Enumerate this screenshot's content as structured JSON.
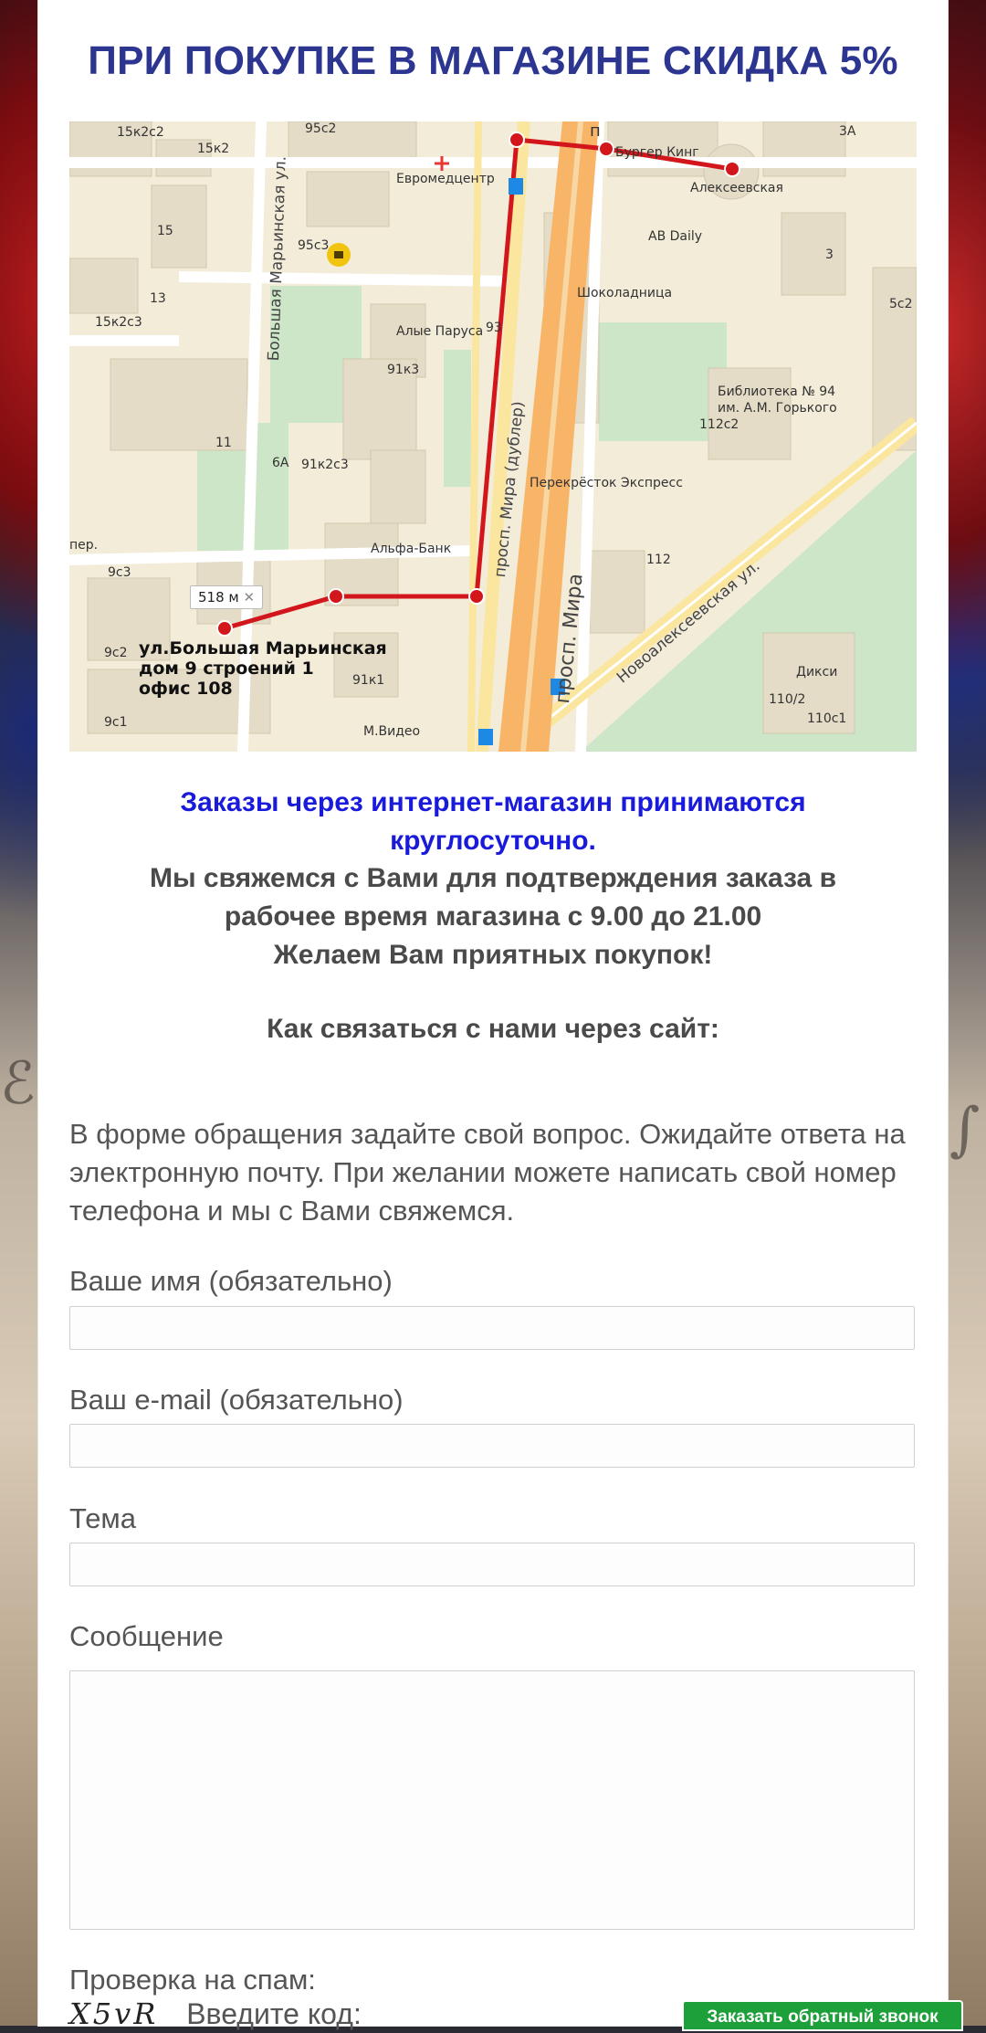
{
  "heading": "ПРИ ПОКУПКЕ В МАГАЗИНЕ СКИДКА 5%",
  "map": {
    "distance": "518 м",
    "address_lines": [
      "ул.Большая Марьинская",
      "дом 9 строений 1",
      "офис 108"
    ],
    "labels": {
      "euromed": "Евромедцентр",
      "burger": "Бургер Кинг",
      "alekseevskaya": "Алексеевская",
      "abdaily": "AB Daily",
      "shokoladnitsa": "Шоколадница",
      "alye_parusa": "Алые Паруса",
      "library_1": "Библиотека № 94",
      "library_2": "им. А.М. Горького",
      "perekrestok": "Перекрёсток Экспресс",
      "alfabank": "Альфа-Банк",
      "mvideo": "М.Видео",
      "diksi": "Дикси",
      "b15k2c2": "15к2с2",
      "b15k2": "15к2",
      "b95c2": "95с2",
      "b95c3": "95с3",
      "b15": "15",
      "b13": "13",
      "b15k2c3": "15к2с3",
      "b11": "11",
      "b6a": "6А",
      "b91k2c3": "91к2с3",
      "b91k3": "91к3",
      "b93": "93",
      "b9c3": "9с3",
      "b9c2": "9с2",
      "b9c1": "9с1",
      "b91k1": "91к1",
      "b3a": "3А",
      "b3": "3",
      "b5c2": "5с2",
      "b112c2": "112с2",
      "b112": "112",
      "b110c2": "110/2",
      "b110c1": "110с1",
      "per": "пер.",
      "street_marinskaya": "Большая Марьинская ул.",
      "street_mira_dubler": "просп. Мира (дублер)",
      "street_mira": "просп. Мира",
      "street_novoalekseevskaya": "Новоалексеевская ул.",
      "street_p": "п"
    }
  },
  "info_blue": [
    "Заказы через интернет-магазин принимаются",
    "круглосуточно."
  ],
  "info_gray": [
    "Мы свяжемся с Вами для подтверждения заказа в",
    "рабочее время магазина с 9.00 до 21.00",
    "Желаем Вам приятных покупок!"
  ],
  "contact_heading": "Как связаться с нами через сайт:",
  "paragraph": "В форме обращения задайте свой вопрос. Ожидайте ответа на электронную почту. При желании можете написать свой номер телефона и мы с Вами свяжемся.",
  "form": {
    "name_label": "Ваше имя (обязательно)",
    "email_label": "Ваш e-mail (обязательно)",
    "subject_label": "Тема",
    "message_label": "Сообщение",
    "spam_label": "Проверка на спам:",
    "captcha_code": "X5vR",
    "captcha_prompt": "Введите код:"
  },
  "callback_button": "Заказать обратный звонок"
}
